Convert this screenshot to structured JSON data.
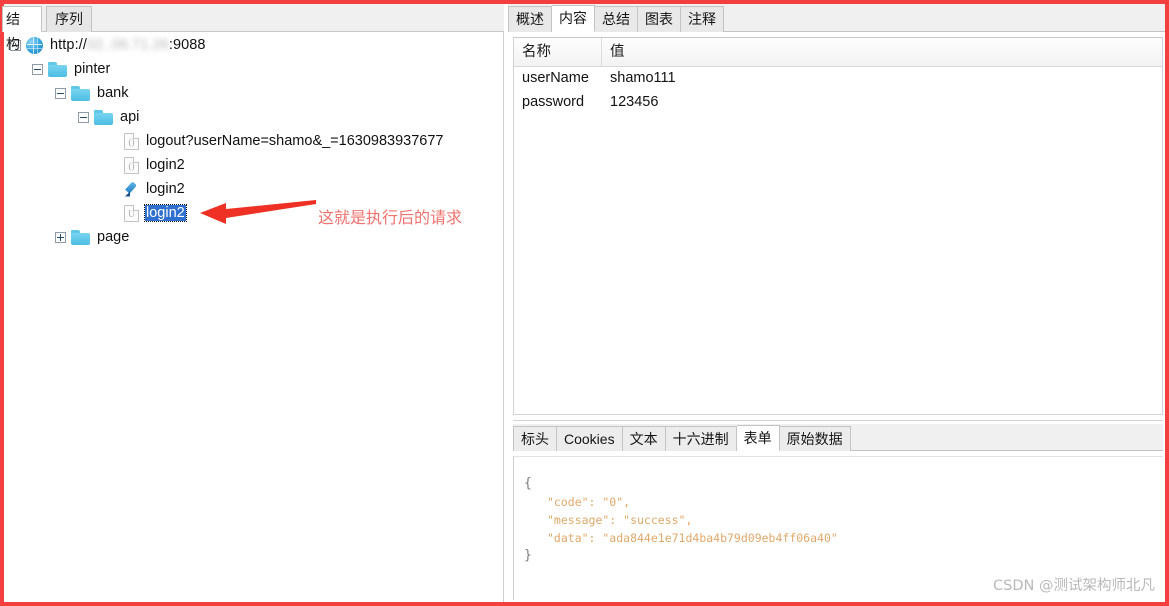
{
  "window": {
    "annotation_color": "#f43f3f",
    "watermark": "CSDN @测试架构师北凡"
  },
  "left_panel": {
    "tabs": [
      {
        "label": "结构",
        "active": true
      },
      {
        "label": "序列",
        "active": false
      }
    ],
    "tree": {
      "root": {
        "icon": "globe-icon",
        "url_prefix": "http://",
        "url_blurred": "02..06.71.26",
        "url_suffix": ":9088",
        "label": "http://02..06.71.26:9088",
        "expanded": true
      },
      "nodes": [
        {
          "level": 1,
          "icon": "folder-icon",
          "label": "pinter",
          "expanded": true,
          "twisty": "expanded"
        },
        {
          "level": 2,
          "icon": "folder-icon",
          "label": "bank",
          "expanded": true,
          "twisty": "expanded"
        },
        {
          "level": 3,
          "icon": "folder-icon",
          "label": "api",
          "expanded": true,
          "twisty": "expanded"
        },
        {
          "level": 4,
          "icon": "doc-icon",
          "icon_glyph": "()",
          "label": "logout?userName=shamo&_=1630983937677",
          "twisty": "none",
          "selected": false
        },
        {
          "level": 4,
          "icon": "doc-icon",
          "icon_glyph": "()",
          "label": "login2",
          "twisty": "none",
          "selected": false
        },
        {
          "level": 4,
          "icon": "pen-icon",
          "icon_glyph": "",
          "label": "login2",
          "twisty": "none",
          "selected": false
        },
        {
          "level": 4,
          "icon": "doc-icon",
          "icon_glyph": "U",
          "label": "login2",
          "twisty": "none",
          "selected": true
        },
        {
          "level": 2,
          "icon": "folder-icon",
          "label": "page",
          "expanded": false,
          "twisty": "collapsed"
        }
      ]
    },
    "annotation": {
      "text": "这就是执行后的请求",
      "arrow": "left-arrow-icon",
      "color": "#f1716e"
    }
  },
  "right_panel": {
    "tabs": [
      {
        "label": "概述",
        "active": false
      },
      {
        "label": "内容",
        "active": true
      },
      {
        "label": "总结",
        "active": false
      },
      {
        "label": "图表",
        "active": false
      },
      {
        "label": "注释",
        "active": false
      }
    ],
    "kv_grid": {
      "columns": [
        "名称",
        "值"
      ],
      "rows": [
        {
          "name": "userName",
          "value": "shamo111"
        },
        {
          "name": "password",
          "value": "123456"
        }
      ]
    },
    "bottom_tabs": [
      {
        "label": "标头",
        "active": false
      },
      {
        "label": "Cookies",
        "active": false
      },
      {
        "label": "文本",
        "active": false
      },
      {
        "label": "十六进制",
        "active": false
      },
      {
        "label": "表单",
        "active": true
      },
      {
        "label": "原始数据",
        "active": false
      }
    ],
    "json_body": {
      "open_brace": "{",
      "lines": [
        "\"code\": \"0\",",
        "\"message\": \"success\",",
        "\"data\": \"ada844e1e71d4ba4b79d09eb4ff06a40\""
      ],
      "close_brace": "}"
    }
  }
}
